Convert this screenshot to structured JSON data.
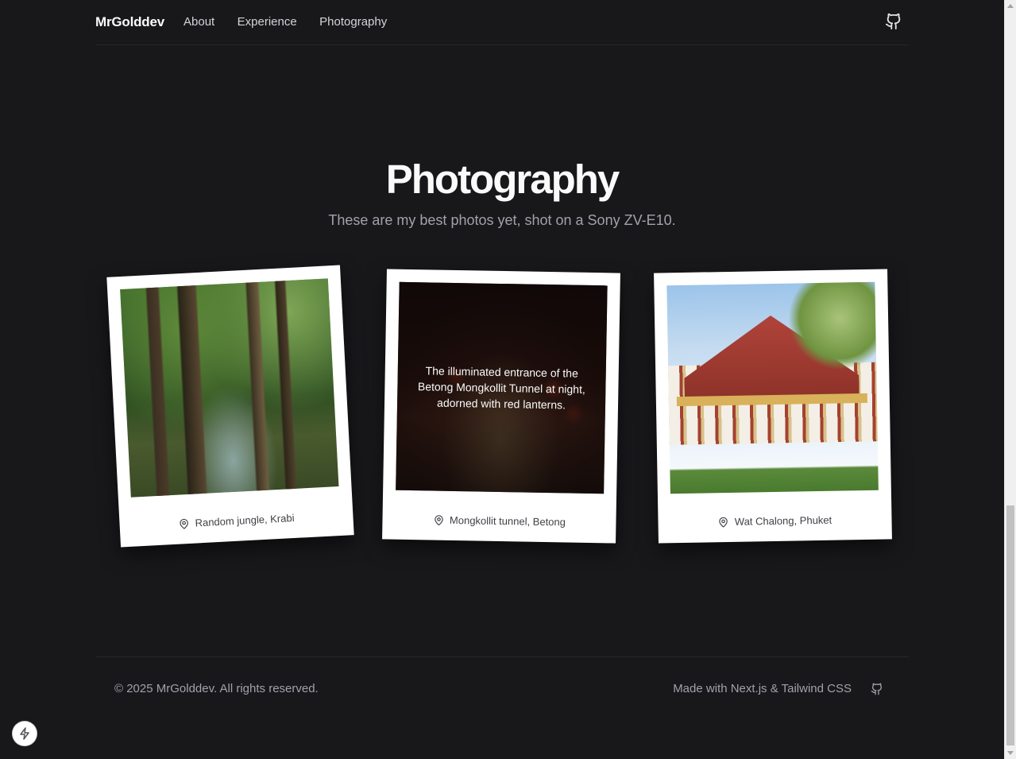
{
  "header": {
    "brand": "MrGolddev",
    "nav": [
      {
        "label": "About"
      },
      {
        "label": "Experience"
      },
      {
        "label": "Photography"
      }
    ],
    "github_icon": "github-icon"
  },
  "hero": {
    "title": "Photography",
    "subtitle": "These are my best photos yet, shot on a Sony ZV-E10."
  },
  "photos": [
    {
      "location": "Random jungle, Krabi",
      "icon": "map-pin-icon"
    },
    {
      "location": "Mongkollit tunnel, Betong",
      "icon": "map-pin-icon",
      "hover_description": "The illuminated entrance of the Betong Mongkollit Tunnel at night, adorned with red lanterns."
    },
    {
      "location": "Wat Chalong, Phuket",
      "icon": "map-pin-icon"
    }
  ],
  "footer": {
    "copyright": "© 2025 MrGolddev. All rights reserved.",
    "made_with": "Made with Next.js & Tailwind CSS",
    "github_icon": "github-icon"
  },
  "dev_indicator_icon": "lightning-bolt-icon",
  "colors": {
    "background": "#18181b",
    "border": "#27272a",
    "text_primary": "#fafafa",
    "text_muted": "#a1a1aa"
  }
}
